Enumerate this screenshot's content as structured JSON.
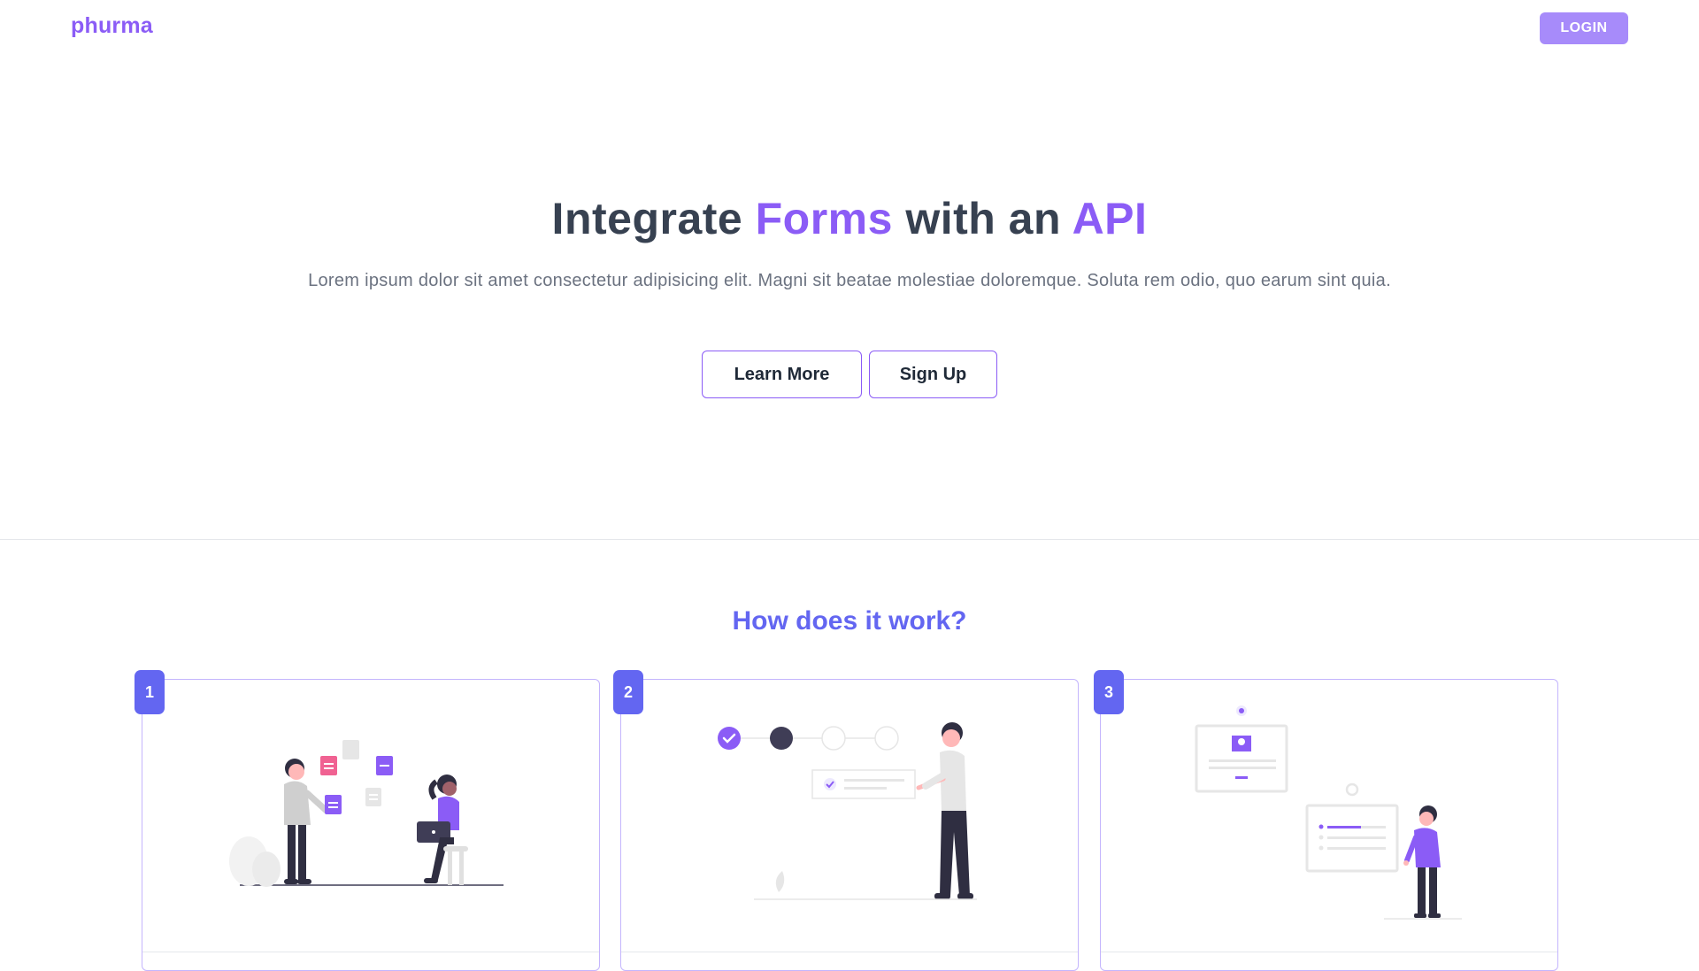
{
  "nav": {
    "logo": "phurma",
    "login_label": "LOGIN"
  },
  "hero": {
    "title_part1": "Integrate ",
    "title_accent1": "Forms",
    "title_part2": " with an ",
    "title_accent2": "API",
    "subtitle": "Lorem ipsum dolor sit amet consectetur adipisicing elit. Magni sit beatae molestiae doloremque. Soluta rem odio, quo earum sint quia.",
    "learn_more_label": "Learn More",
    "sign_up_label": "Sign Up"
  },
  "how": {
    "title": "How does it work?",
    "steps": [
      {
        "number": "1",
        "illustration": "people-sharing-forms-illustration"
      },
      {
        "number": "2",
        "illustration": "progress-steps-illustration"
      },
      {
        "number": "3",
        "illustration": "profile-cards-illustration"
      }
    ]
  },
  "colors": {
    "brand": "#8b5cf6",
    "accent": "#6366f1",
    "login_bg": "#a78bfa",
    "text_dark": "#374151",
    "text_muted": "#6b7280"
  }
}
